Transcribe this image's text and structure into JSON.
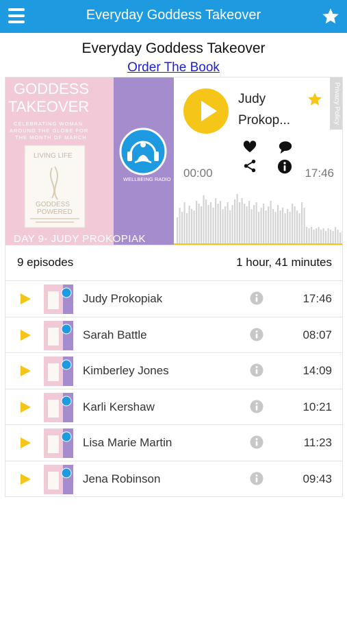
{
  "app_bar": {
    "title": "Everyday Goddess Takeover",
    "menu_icon": "hamburger-menu-icon",
    "favorite_icon": "star-icon"
  },
  "page": {
    "title": "Everyday Goddess Takeover",
    "book_link": "Order The Book"
  },
  "player": {
    "cover": {
      "headline_line1": "GODDESS",
      "headline_line2": "TAKEOVER",
      "tagline_line1": "CELEBRATING WOMAN",
      "tagline_line2": "AROUND THE GLOBE FOR",
      "tagline_line3": "THE MONTH OF MARCH",
      "book_line1": "LIVING LIFE",
      "book_line2": "GODDESS",
      "book_line3": "POWERED",
      "station": "WELLBEING RADIO",
      "footer": "DAY 9- JUDY PROKOPIAK"
    },
    "episode_title_line1": "Judy",
    "episode_title_line2": "Prokop...",
    "current_time": "00:00",
    "duration": "17:46",
    "privacy_label": "Privacy Policy",
    "progress": 0,
    "colors": {
      "accent": "#f5c518",
      "header": "#1e9be0",
      "cover_pink": "#f2c9d6",
      "cover_purple": "#a58ccc"
    }
  },
  "summary": {
    "episode_count": "9 episodes",
    "total_duration": "1 hour, 41 minutes"
  },
  "episodes": [
    {
      "name": "Judy Prokopiak",
      "duration": "17:46"
    },
    {
      "name": "Sarah Battle",
      "duration": "08:07"
    },
    {
      "name": "Kimberley Jones",
      "duration": "14:09"
    },
    {
      "name": "Karli Kershaw",
      "duration": "10:21"
    },
    {
      "name": "Lisa Marie Martin",
      "duration": "11:23"
    },
    {
      "name": "Jena Robinson",
      "duration": "09:43"
    }
  ]
}
